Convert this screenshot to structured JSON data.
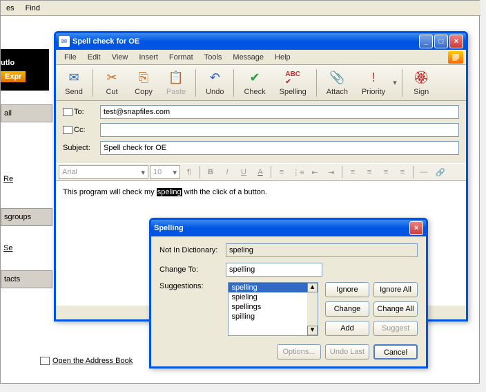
{
  "bg": {
    "menu": {
      "es": "es",
      "find": "Find"
    },
    "logo": {
      "line1": "utlo",
      "line2": "Expr"
    },
    "side": {
      "ail": "ail",
      "re": "Re",
      "sgroups": "sgroups",
      "se": "Se",
      "tacts": "tacts"
    },
    "addr_link": "Open the Address Book"
  },
  "window": {
    "title": "Spell check for OE",
    "menu": {
      "file": "File",
      "edit": "Edit",
      "view": "View",
      "insert": "Insert",
      "format": "Format",
      "tools": "Tools",
      "message": "Message",
      "help": "Help"
    },
    "toolbar": {
      "send": "Send",
      "cut": "Cut",
      "copy": "Copy",
      "paste": "Paste",
      "undo": "Undo",
      "check": "Check",
      "spelling": "Spelling",
      "attach": "Attach",
      "priority": "Priority",
      "sign": "Sign"
    },
    "fields": {
      "to_label": "To:",
      "to_value": "test@snapfiles.com",
      "cc_label": "Cc:",
      "cc_value": "",
      "subject_label": "Subject:",
      "subject_value": "Spell check for OE"
    },
    "font": {
      "name": "Arial",
      "size": "10"
    },
    "body": {
      "before": "This program will check my ",
      "highlighted": "speling",
      "after": " with the click of a button."
    }
  },
  "spell": {
    "title": "Spelling",
    "not_in_dict_label": "Not In Dictionary:",
    "not_in_dict_value": "speling",
    "change_to_label": "Change To:",
    "change_to_value": "spelling",
    "suggestions_label": "Suggestions:",
    "suggestions": [
      "spelling",
      "spieling",
      "spellings",
      "spilling"
    ],
    "buttons": {
      "ignore": "Ignore",
      "ignore_all": "Ignore All",
      "change": "Change",
      "change_all": "Change All",
      "add": "Add",
      "suggest": "Suggest",
      "options": "Options...",
      "undo_last": "Undo Last",
      "cancel": "Cancel"
    }
  }
}
